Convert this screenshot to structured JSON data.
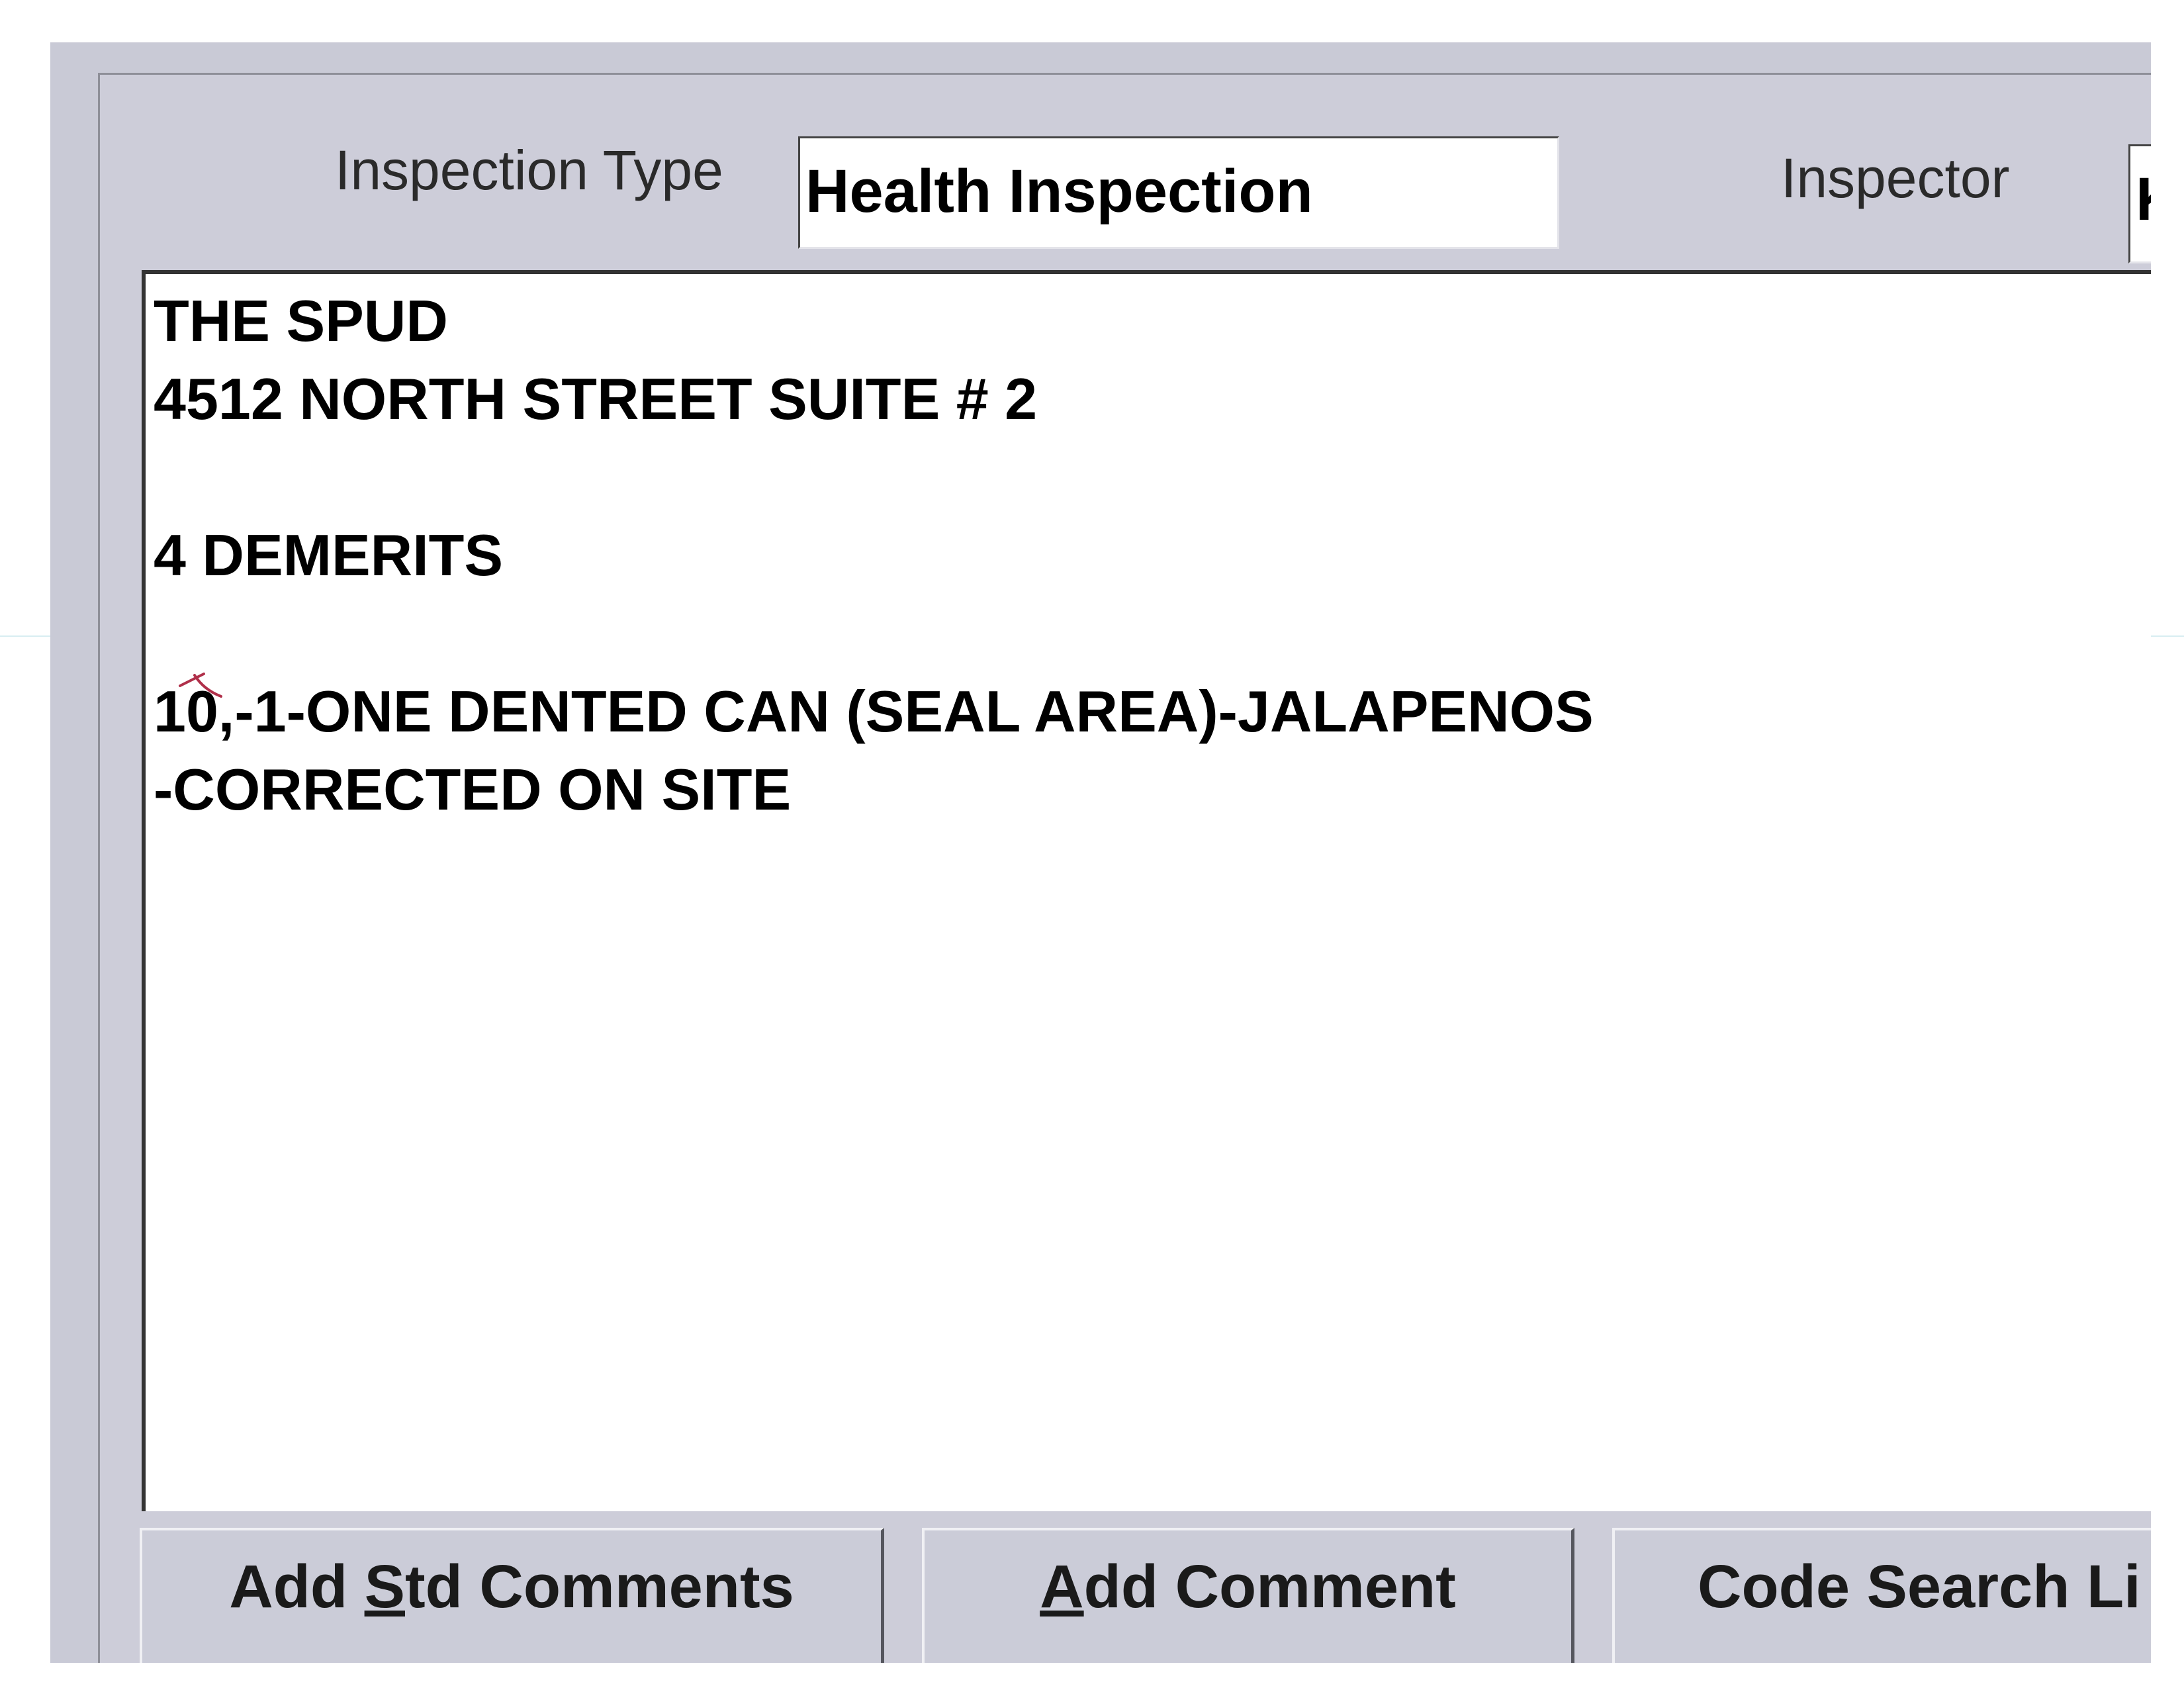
{
  "header": {
    "inspection_type_label": "Inspection Type",
    "inspection_type_value": "Health Inspection",
    "inspector_label": "Inspector",
    "inspector_value": "Ke"
  },
  "comments": {
    "lines": [
      "THE SPUD",
      "4512 NORTH STREET SUITE # 2",
      "",
      "4 DEMERITS",
      "",
      "10,-1-ONE DENTED CAN (SEAL AREA)-JALAPENOS",
      "-CORRECTED ON SITE"
    ]
  },
  "buttons": {
    "add_std_comments": {
      "prefix": "Add ",
      "mnemonic": "S",
      "suffix": "td Comments"
    },
    "add_comment": {
      "prefix": "",
      "mnemonic": "A",
      "suffix": "dd Comment"
    },
    "code_search": {
      "label": "Code Search Li"
    }
  },
  "colors": {
    "window_bg": "#c9cad6",
    "field_bg": "#ffffff",
    "handwritten_mark": "#b0304a"
  }
}
